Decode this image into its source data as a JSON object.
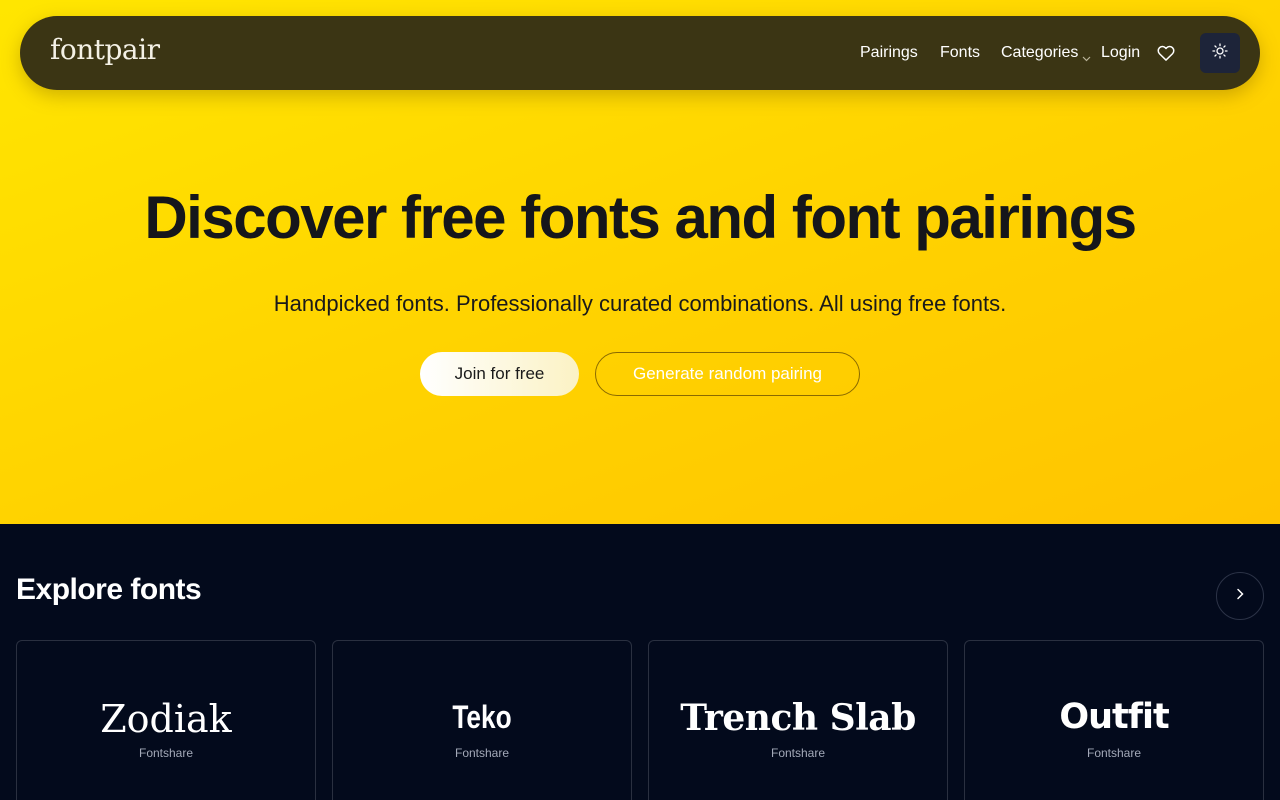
{
  "nav": {
    "logo": "fontpair",
    "links": [
      "Pairings",
      "Fonts",
      "Categories",
      "Login"
    ]
  },
  "hero": {
    "title": "Discover free fonts and font pairings",
    "subtitle": "Handpicked fonts. Professionally curated combinations. All using free fonts.",
    "join_button": "Join for free",
    "random_button": "Generate random pairing"
  },
  "explore": {
    "title": "Explore fonts",
    "cards": [
      {
        "name": "Zodiak",
        "source": "Fontshare"
      },
      {
        "name": "Teko",
        "source": "Fontshare"
      },
      {
        "name": "Trench Slab",
        "source": "Fontshare"
      },
      {
        "name": "Outfit",
        "source": "Fontshare"
      }
    ]
  },
  "icons": {
    "dropdown": "chevron-down-icon",
    "favorites": "heart-icon",
    "theme": "sun-icon",
    "next": "chevron-right-icon"
  },
  "colors": {
    "hero_bg": "#ffd800",
    "nav_bg": "#3b3514",
    "page_bg": "#030a1c",
    "theme_button_bg": "#1d2439"
  }
}
